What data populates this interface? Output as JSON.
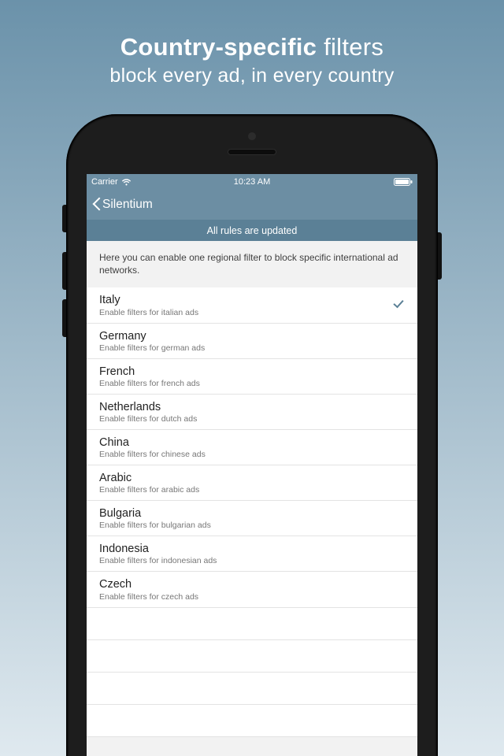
{
  "promo": {
    "line1_bold": "Country-specific",
    "line1_light": " filters",
    "line2": "block every ad, in every country"
  },
  "statusbar": {
    "carrier": "Carrier",
    "time": "10:23 AM"
  },
  "navbar": {
    "back_label": "Silentium"
  },
  "banner": {
    "text": "All rules are updated"
  },
  "description": {
    "text": "Here you can enable one regional filter to block specific international ad networks."
  },
  "filters": [
    {
      "title": "Italy",
      "subtitle": "Enable filters for italian ads",
      "selected": true
    },
    {
      "title": "Germany",
      "subtitle": "Enable filters for german ads",
      "selected": false
    },
    {
      "title": "French",
      "subtitle": "Enable filters for french ads",
      "selected": false
    },
    {
      "title": "Netherlands",
      "subtitle": "Enable filters for dutch ads",
      "selected": false
    },
    {
      "title": "China",
      "subtitle": "Enable filters for chinese ads",
      "selected": false
    },
    {
      "title": "Arabic",
      "subtitle": "Enable filters for arabic ads",
      "selected": false
    },
    {
      "title": "Bulgaria",
      "subtitle": "Enable filters for bulgarian ads",
      "selected": false
    },
    {
      "title": "Indonesia",
      "subtitle": "Enable filters for indonesian ads",
      "selected": false
    },
    {
      "title": "Czech",
      "subtitle": "Enable filters for czech ads",
      "selected": false
    }
  ],
  "empty_rows": 4,
  "colors": {
    "accent": "#6c8ea3",
    "accent_dark": "#5b8096"
  }
}
